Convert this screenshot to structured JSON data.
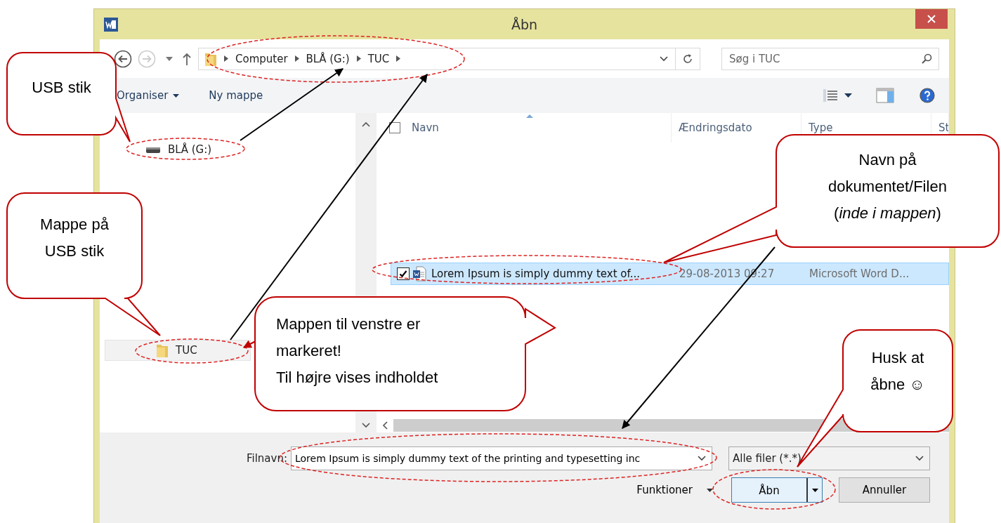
{
  "window": {
    "title": "Åbn"
  },
  "back": {
    "disabled": false
  },
  "forward": {
    "disabled": true
  },
  "address": {
    "crumbs": [
      "Computer",
      "BLÅ (G:)",
      "TUC"
    ]
  },
  "search": {
    "placeholder": "Søg i TUC"
  },
  "toolbar": {
    "organise": "Organiser",
    "new_folder": "Ny mappe"
  },
  "nav_pane": {
    "items": [
      {
        "kind": "drive",
        "label": "BLÅ (G:)",
        "selected": false
      },
      {
        "kind": "folder",
        "label": "TUC",
        "selected": true
      }
    ]
  },
  "file_list": {
    "select_all": {
      "checked": false
    },
    "columns": [
      "Navn",
      "Ændringsdato",
      "Type",
      "St"
    ],
    "rows": [
      {
        "name": "Lorem Ipsum is simply dummy text of...",
        "date": "29-08-2013 09:27",
        "type": "Microsoft Word D...",
        "selected": true,
        "checked": true
      }
    ]
  },
  "filename": {
    "label": "Filnavn:",
    "value": "Lorem Ipsum is simply dummy text of the printing and typesetting inc"
  },
  "filter": {
    "value": "Alle filer (*.*)"
  },
  "tools": {
    "label": "Funktioner"
  },
  "buttons": {
    "open": "Åbn",
    "cancel": "Annuller"
  },
  "annotations": [
    {
      "lines": [
        "USB stik"
      ]
    },
    {
      "lines": [
        "Mappe på",
        "USB stik"
      ]
    },
    {
      "lines": [
        "Mappen til venstre er",
        "markeret!",
        "Til højre vises indholdet"
      ]
    },
    {
      "lines": [
        "Navn på",
        "dokumentet/Filen",
        "(*inde i mappen*)"
      ]
    },
    {
      "lines": [
        "Husk at",
        "åbne ☺"
      ]
    }
  ]
}
